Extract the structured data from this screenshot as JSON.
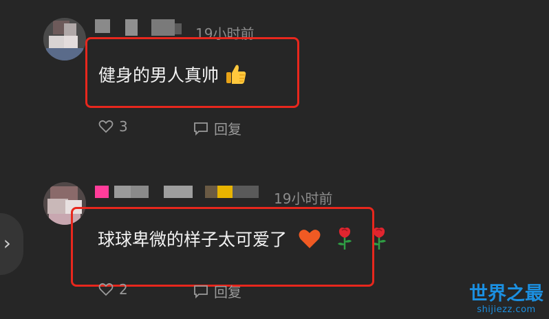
{
  "comments": [
    {
      "time": "19小时前",
      "text": "健身的男人真帅",
      "emoji": "thumbs-up",
      "likes": "3",
      "reply_label": "回复"
    },
    {
      "time": "19小时前",
      "text": "球球卑微的样子太可爱了",
      "emojis": [
        "heart",
        "rose",
        "rose"
      ],
      "likes": "2",
      "reply_label": "回复"
    }
  ],
  "watermark": {
    "title": "世界之最",
    "url": "shijiezz.com"
  },
  "colors": {
    "background": "#262626",
    "highlight": "#e8271d",
    "watermark": "#1b8fe0"
  }
}
